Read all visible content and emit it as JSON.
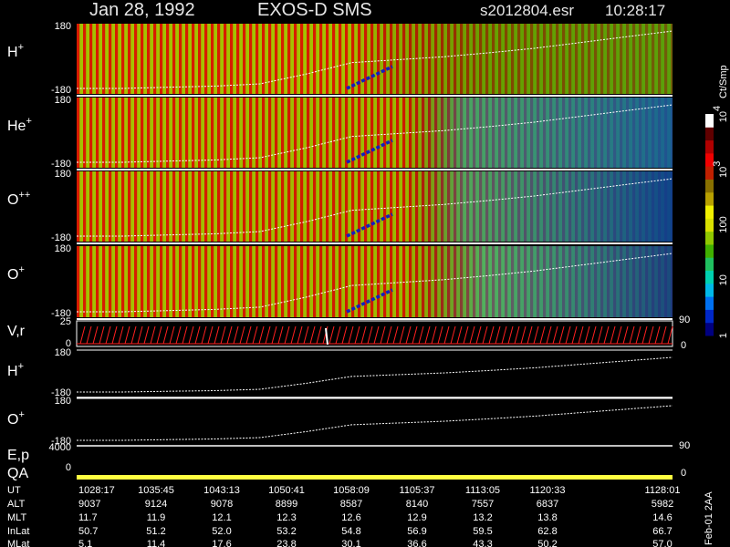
{
  "header": {
    "date": "Jan 28, 1992",
    "instrument": "EXOS-D SMS",
    "file": "s2012804.esr",
    "time": "10:28:17"
  },
  "chart_data": {
    "type": "heatmap",
    "panels": [
      {
        "label": "H",
        "sup": "+",
        "ytop": "180",
        "ybot": "-180"
      },
      {
        "label": "He",
        "sup": "+",
        "ytop": "180",
        "ybot": "-180"
      },
      {
        "label": "O",
        "sup": "++",
        "ytop": "180",
        "ybot": "-180"
      },
      {
        "label": "O",
        "sup": "+",
        "ytop": "180",
        "ybot": "-180"
      }
    ],
    "vr_panel": {
      "label": "V,r",
      "ytop": "25",
      "ybot": "0",
      "right_top": "90",
      "right_bot": "0"
    },
    "line_panels": [
      {
        "label": "H",
        "sup": "+",
        "ytop": "180",
        "ybot": "-180"
      },
      {
        "label": "O",
        "sup": "+",
        "ytop": "180",
        "ybot": "-180"
      }
    ],
    "ep_panel": {
      "label": "E,p",
      "ytop": "4000",
      "right_top": "90"
    },
    "qa_panel": {
      "label": "QA",
      "ybot": "0",
      "right_bot": "0"
    },
    "colorbar": {
      "unit": "Ct/Smp",
      "ticks": [
        {
          "label": "10",
          "sup": "4",
          "level": 1.0
        },
        {
          "label": "10",
          "sup": "3",
          "level": 0.75
        },
        {
          "label": "100",
          "sup": "",
          "level": 0.5
        },
        {
          "label": "10",
          "sup": "",
          "level": 0.25
        },
        {
          "label": "1",
          "sup": "",
          "level": 0.0
        }
      ],
      "colors": [
        "#000080",
        "#0028c8",
        "#0070f0",
        "#00b8e8",
        "#00d0b0",
        "#20c060",
        "#40b000",
        "#90c800",
        "#d8e000",
        "#f0f000",
        "#b8a000",
        "#887000",
        "#c02000",
        "#f00000",
        "#b00000",
        "#600000",
        "#ffffff"
      ]
    },
    "trace_points": [
      0,
      0,
      0.02,
      0.04,
      0.08,
      0.25,
      0.45,
      0.5,
      0.55,
      0.62,
      0.7,
      0.8,
      0.9,
      1.0
    ],
    "footer": {
      "row_labels": [
        "UT",
        "ALT",
        "MLT",
        "InLat",
        "MLat"
      ],
      "columns": [
        [
          "1028:17",
          "9037",
          "11.7",
          "50.7",
          "5.1"
        ],
        [
          "1035:45",
          "9124",
          "11.9",
          "51.2",
          "11.4"
        ],
        [
          "1043:13",
          "9078",
          "12.1",
          "52.0",
          "17.6"
        ],
        [
          "1050:41",
          "8899",
          "12.3",
          "53.2",
          "23.8"
        ],
        [
          "1058:09",
          "8587",
          "12.6",
          "54.8",
          "30.1"
        ],
        [
          "1105:37",
          "8140",
          "12.9",
          "56.9",
          "36.6"
        ],
        [
          "1113:05",
          "7557",
          "13.2",
          "59.5",
          "43.3"
        ],
        [
          "1120:33",
          "6837",
          "13.8",
          "62.8",
          "50.2"
        ],
        [
          "1128:01",
          "5982",
          "14.6",
          "66.7",
          "57.0"
        ]
      ]
    },
    "stamp": "Feb-01 2AA"
  }
}
